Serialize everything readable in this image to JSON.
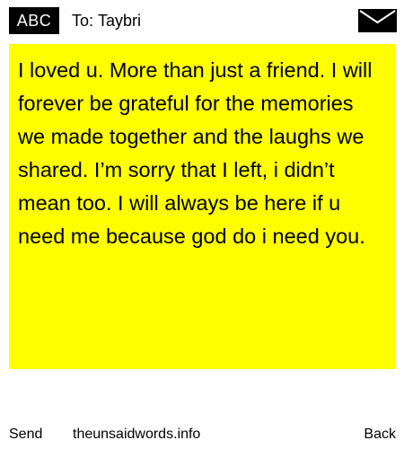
{
  "header": {
    "badge_label": "ABC",
    "to_prefix": "To:",
    "recipient": "Taybri",
    "envelope_icon": "envelope-icon"
  },
  "note": {
    "background_color": "#ffff00",
    "message": "I loved u. More than just a friend. I will forever be grateful for the memories we made together and the laughs we shared. I’m sorry that I left, i didn’t mean too. I will always be here if u need me because god do i need you."
  },
  "footer": {
    "send_label": "Send",
    "site_label": "theunsaidwords.info",
    "back_label": "Back"
  }
}
